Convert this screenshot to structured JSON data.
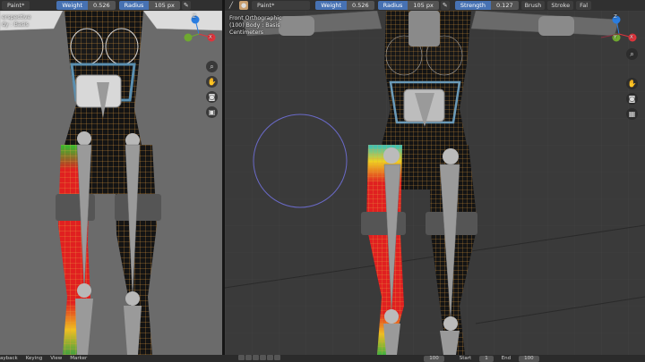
{
  "left_header": {
    "mode_label": "Paint*",
    "weight_label": "Weight",
    "weight_value": "0.526",
    "radius_label": "Radius",
    "radius_value": "105 px"
  },
  "right_header": {
    "mode_label": "Paint*",
    "weight_label": "Weight",
    "weight_value": "0.526",
    "radius_label": "Radius",
    "radius_value": "105 px",
    "strength_label": "Strength",
    "strength_value": "0.127",
    "brush_menu": "Brush",
    "stroke_menu": "Stroke",
    "falloff_menu": "Fal"
  },
  "left_viewport": {
    "info_line1": "erspective",
    "info_line2": "dy : Basis"
  },
  "right_viewport": {
    "info_line1": "Front Orthographic",
    "info_line2": "(100) Body : Basis",
    "info_line3": "Centimeters"
  },
  "gizmo": {
    "x_axis": "X",
    "y_axis": "Y",
    "z_axis": "Z"
  },
  "footer": {
    "playback": "ayback",
    "keying": "Keying",
    "view": "View",
    "marker": "Marker",
    "current_frame": "100",
    "start_label": "Start",
    "start_value": "1",
    "end_label": "End",
    "end_value": "100"
  },
  "colors": {
    "accent": "#4772b3",
    "viewport_left_bg": "#6b6b6b",
    "viewport_right_bg": "#3a3a3a",
    "wire": "#e8a040",
    "weight_red": "#e02020",
    "bone": "#9a9a9a",
    "brush_circle": "#6a6ac8"
  },
  "icons": [
    "brush-icon",
    "mode-icon",
    "pin-icon",
    "zoom-icon",
    "hand-icon",
    "camera-icon",
    "lock-icon",
    "grid-icon"
  ]
}
